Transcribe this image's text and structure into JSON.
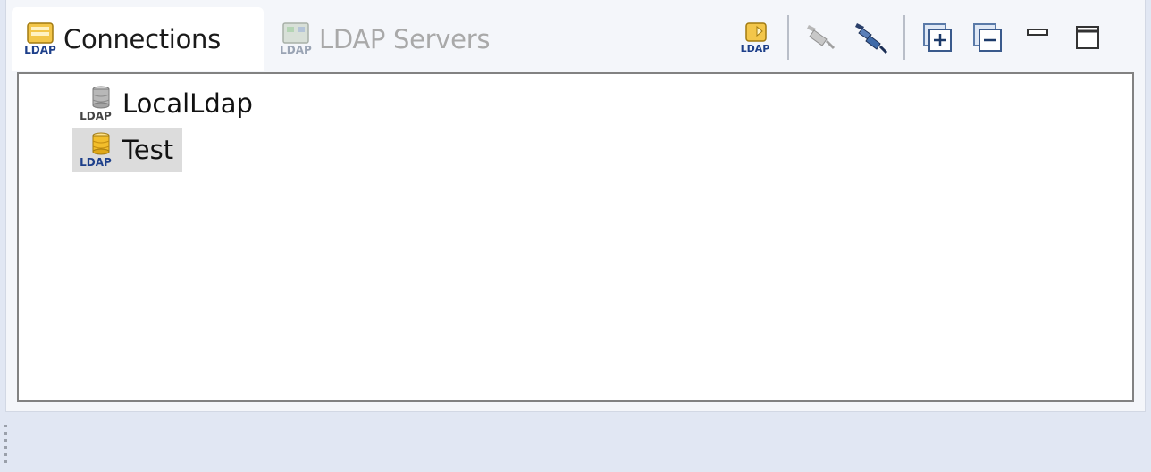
{
  "tabs": [
    {
      "label": "Connections",
      "active": true,
      "icon": "ldap-connections-icon"
    },
    {
      "label": "LDAP Servers",
      "active": false,
      "icon": "ldap-servers-icon"
    }
  ],
  "toolbar": {
    "buttons": [
      {
        "name": "new-connection-button",
        "icon": "ldap-new-connection-icon"
      },
      {
        "name": "close-connection-button",
        "icon": "disconnect-plug-icon"
      },
      {
        "name": "open-connection-button",
        "icon": "connect-plug-icon"
      },
      {
        "name": "expand-all-button",
        "icon": "expand-all-icon"
      },
      {
        "name": "collapse-all-button",
        "icon": "collapse-all-icon"
      },
      {
        "name": "minimize-button",
        "icon": "minimize-icon"
      },
      {
        "name": "maximize-button",
        "icon": "maximize-icon"
      }
    ]
  },
  "connections": [
    {
      "label": "LocalLdap",
      "state": "closed",
      "selected": false
    },
    {
      "label": "Test",
      "state": "open",
      "selected": true
    }
  ],
  "colors": {
    "accent_gold": "#e8b21c",
    "closed_gray": "#9a9a9a",
    "selection_bg": "#dcdcdc",
    "panel_bg": "#e1e7f3"
  }
}
